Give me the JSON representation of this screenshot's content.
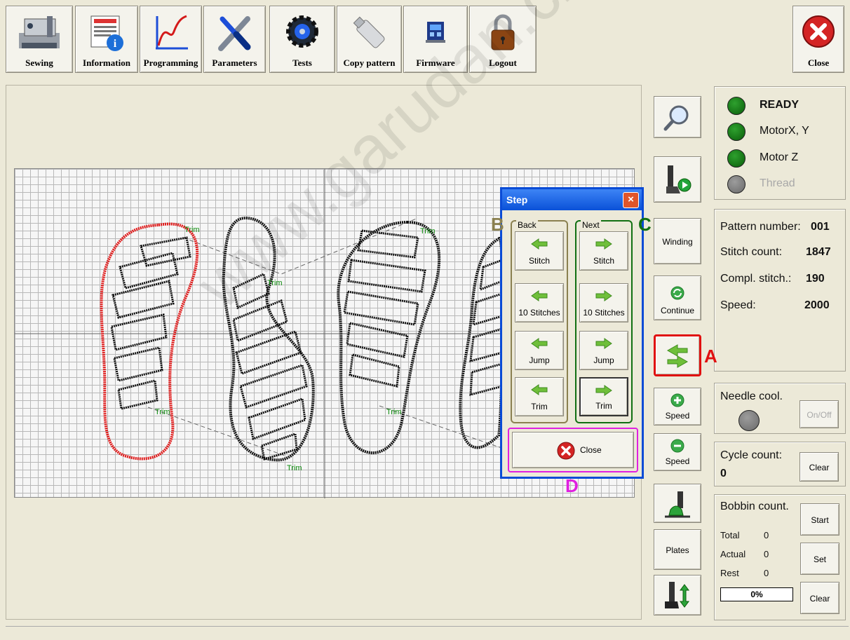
{
  "toolbar": {
    "buttons": [
      {
        "label": "Sewing",
        "icon": "sewing-machine-icon"
      },
      {
        "label": "Information",
        "icon": "information-icon"
      },
      {
        "label": "Programming",
        "icon": "graph-icon"
      },
      {
        "label": "Parameters",
        "icon": "tools-icon"
      },
      {
        "label": "Tests",
        "icon": "gear-icon"
      },
      {
        "label": "Copy pattern",
        "icon": "usb-stick-icon"
      },
      {
        "label": "Firmware",
        "icon": "chip-icon"
      },
      {
        "label": "Logout",
        "icon": "padlock-icon"
      }
    ],
    "close_label": "Close"
  },
  "pattern": {
    "trim_label": "Trim"
  },
  "side_buttons": {
    "zoom_icon": "magnifier-icon",
    "sew_icon": "presser-foot-play-icon",
    "winding": "Winding",
    "continue": "Continue",
    "step_icon": "step-arrows-icon",
    "speed_up": "Speed",
    "speed_down": "Speed",
    "foot_icon": "presser-foot-icon",
    "plates": "Plates",
    "lift_icon": "presser-lift-icon"
  },
  "status": {
    "ready": "READY",
    "motor_xy": "MotorX, Y",
    "motor_z": "Motor Z",
    "thread": "Thread",
    "colors": {
      "ok": "#0a7a0a",
      "off": "#808080"
    }
  },
  "info": {
    "pattern_label": "Pattern number:",
    "pattern_value": "001",
    "stitch_count_label": "Stitch count:",
    "stitch_count_value": "1847",
    "compl_label": "Compl. stitch.:",
    "compl_value": "190",
    "speed_label": "Speed:",
    "speed_value": "2000"
  },
  "needle": {
    "label": "Needle cool.",
    "toggle": "On/Off"
  },
  "cycle": {
    "label": "Cycle count:",
    "value": "0",
    "clear": "Clear"
  },
  "bobbin": {
    "label": "Bobbin count.",
    "total_label": "Total",
    "total_value": "0",
    "actual_label": "Actual",
    "actual_value": "0",
    "rest_label": "Rest",
    "rest_value": "0",
    "progress_text": "0%",
    "progress": 0,
    "start": "Start",
    "set": "Set",
    "clear": "Clear"
  },
  "dialog": {
    "title": "Step",
    "close_x": "×",
    "back_group": "Back",
    "next_group": "Next",
    "back": [
      "Stitch",
      "10 Stitches",
      "Jump",
      "Trim"
    ],
    "next": [
      "Stitch",
      "10 Stitches",
      "Jump",
      "Trim"
    ],
    "close_label": "Close"
  },
  "markers": {
    "a": "A",
    "b": "B",
    "c": "C",
    "d": "D",
    "colors": {
      "a": "#e01010",
      "b": "#8a8050",
      "c": "#127012",
      "d": "#e020e0"
    }
  },
  "watermark": "www.garudan.cz"
}
